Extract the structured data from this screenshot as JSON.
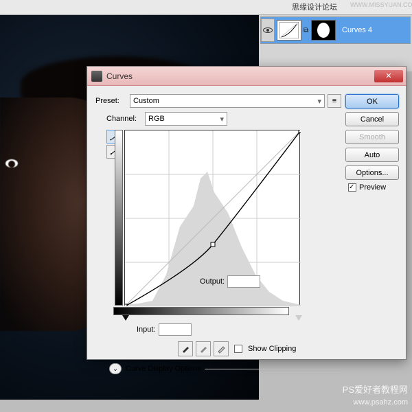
{
  "top": {
    "site": "思缘设计论坛",
    "siteUrl": "WWW.MISSYUAN.COM"
  },
  "layers": {
    "curves4": "Curves 4"
  },
  "dialog": {
    "title": "Curves",
    "presetLabel": "Preset:",
    "presetValue": "Custom",
    "channelLabel": "Channel:",
    "channelValue": "RGB",
    "outputLabel": "Output:",
    "inputLabel": "Input:",
    "showClipping": "Show Clipping",
    "displayOptions": "Curve Display Options"
  },
  "buttons": {
    "ok": "OK",
    "cancel": "Cancel",
    "smooth": "Smooth",
    "auto": "Auto",
    "options": "Options...",
    "preview": "Preview"
  },
  "chart_data": {
    "type": "line",
    "title": "Curves RGB",
    "xlabel": "Input",
    "ylabel": "Output",
    "xlim": [
      0,
      255
    ],
    "ylim": [
      0,
      255
    ],
    "points": [
      {
        "x": 0,
        "y": 0
      },
      {
        "x": 128,
        "y": 90
      },
      {
        "x": 255,
        "y": 255
      }
    ]
  },
  "watermark": {
    "line1": "PS爱好者教程网",
    "line2": "www.psahz.com"
  }
}
